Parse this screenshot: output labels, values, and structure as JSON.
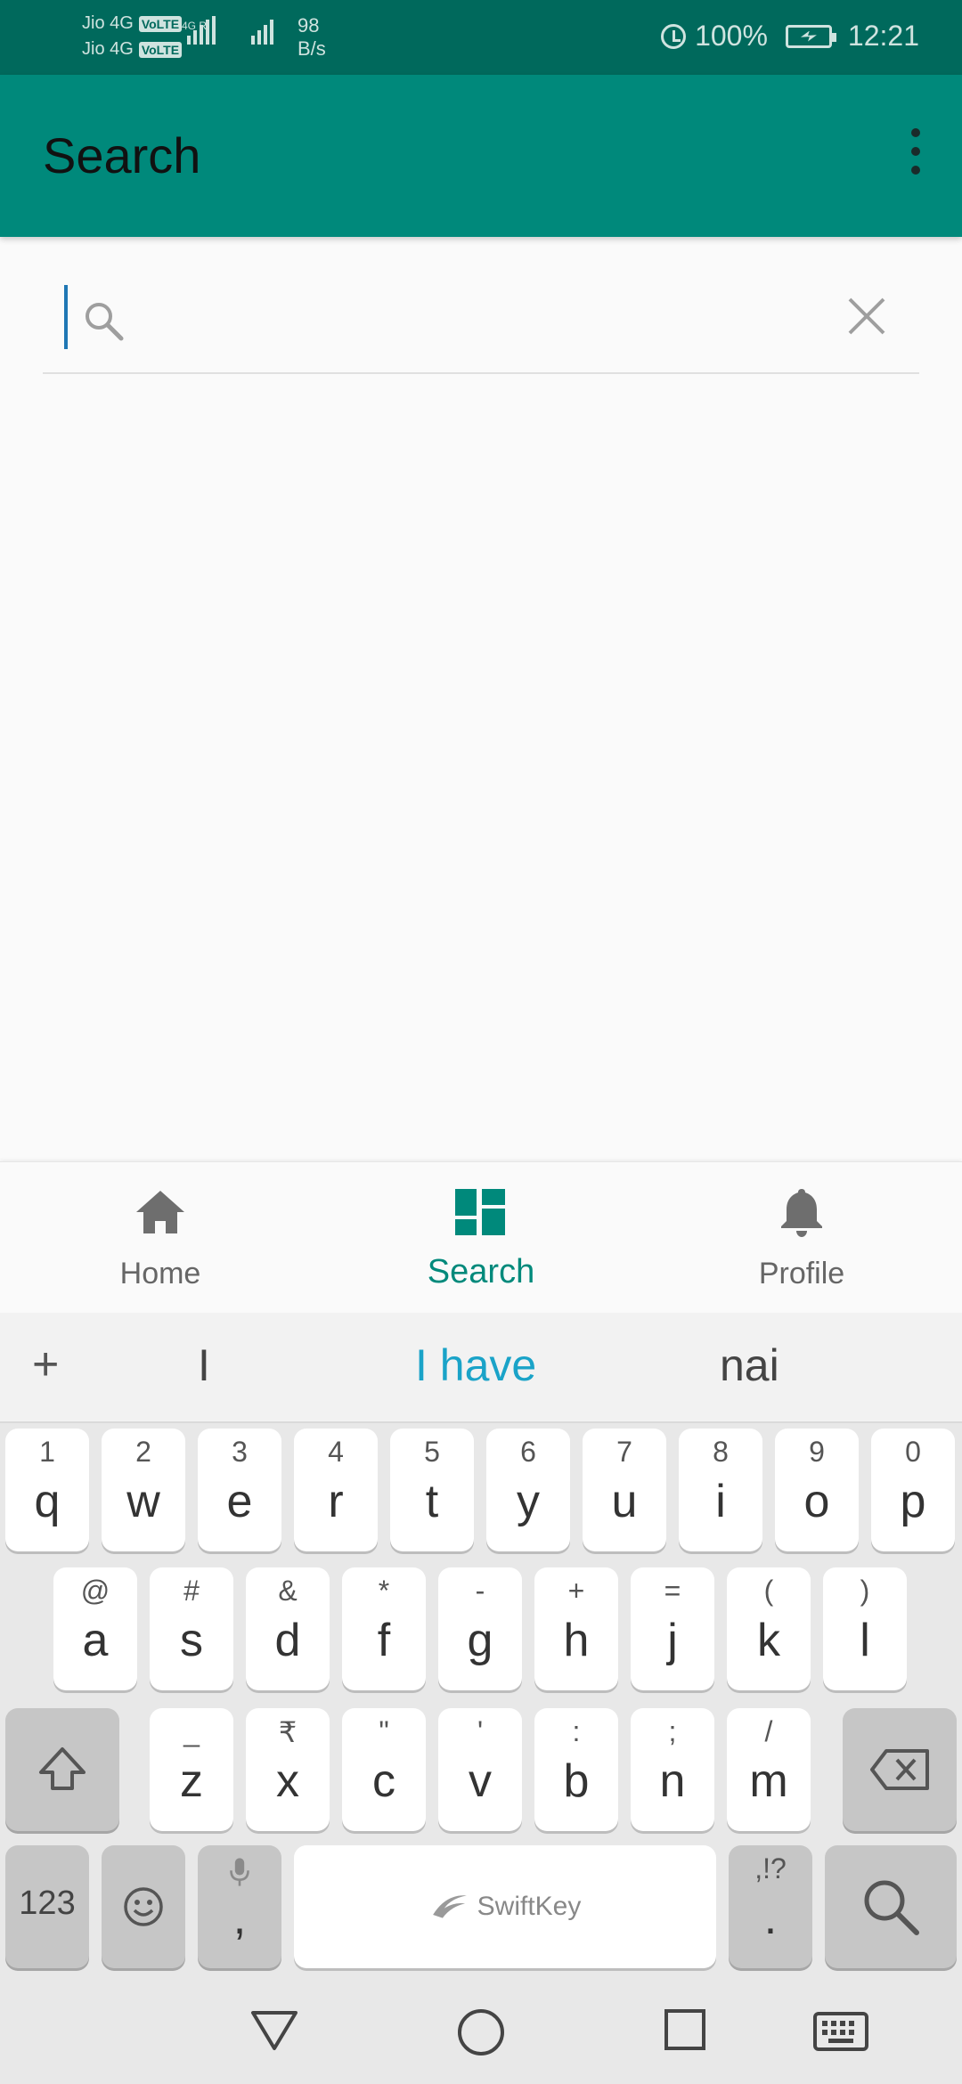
{
  "status_bar": {
    "carrier_1": "Jio 4G",
    "carrier_2": "Jio 4G",
    "volte_1": "VoLTE",
    "volte_2": "VoLTE",
    "net_type": "4G R",
    "net_roam": "R",
    "data_rate_value": "98",
    "data_rate_unit": "B/s",
    "battery": "100%",
    "time": "12:21"
  },
  "app_bar": {
    "title": "Search",
    "overflow_icon": "more-vert-icon"
  },
  "search": {
    "value": "",
    "placeholder": ""
  },
  "bottom_nav": {
    "items": [
      {
        "label": "Home",
        "icon": "home-icon",
        "active": false
      },
      {
        "label": "Search",
        "icon": "dashboard-icon",
        "active": true
      },
      {
        "label": "Profile",
        "icon": "bell-icon",
        "active": false
      }
    ],
    "active_color": "#00897b"
  },
  "keyboard": {
    "suggestions": [
      "I",
      "I have",
      "nai"
    ],
    "plus": "+",
    "row1": [
      {
        "sub": "1",
        "main": "q"
      },
      {
        "sub": "2",
        "main": "w"
      },
      {
        "sub": "3",
        "main": "e"
      },
      {
        "sub": "4",
        "main": "r"
      },
      {
        "sub": "5",
        "main": "t"
      },
      {
        "sub": "6",
        "main": "y"
      },
      {
        "sub": "7",
        "main": "u"
      },
      {
        "sub": "8",
        "main": "i"
      },
      {
        "sub": "9",
        "main": "o"
      },
      {
        "sub": "0",
        "main": "p"
      }
    ],
    "row2": [
      {
        "sub": "@",
        "main": "a"
      },
      {
        "sub": "#",
        "main": "s"
      },
      {
        "sub": "&",
        "main": "d"
      },
      {
        "sub": "*",
        "main": "f"
      },
      {
        "sub": "-",
        "main": "g"
      },
      {
        "sub": "+",
        "main": "h"
      },
      {
        "sub": "=",
        "main": "j"
      },
      {
        "sub": "(",
        "main": "k"
      },
      {
        "sub": ")",
        "main": "l"
      }
    ],
    "row3": [
      {
        "sub": "_",
        "main": "z"
      },
      {
        "sub": "₹",
        "main": "x"
      },
      {
        "sub": "\"",
        "main": "c"
      },
      {
        "sub": "'",
        "main": "v"
      },
      {
        "sub": ":",
        "main": "b"
      },
      {
        "sub": ";",
        "main": "n"
      },
      {
        "sub": "/",
        "main": "m"
      }
    ],
    "numbers_key": "123",
    "comma_key": ",",
    "period_key": ".",
    "period_sub": ",!?",
    "space_brand": "SwiftKey",
    "accent_suggestion": "#1aa3c8"
  },
  "colors": {
    "status_bar": "#00695c",
    "app_bar": "#00897b"
  }
}
